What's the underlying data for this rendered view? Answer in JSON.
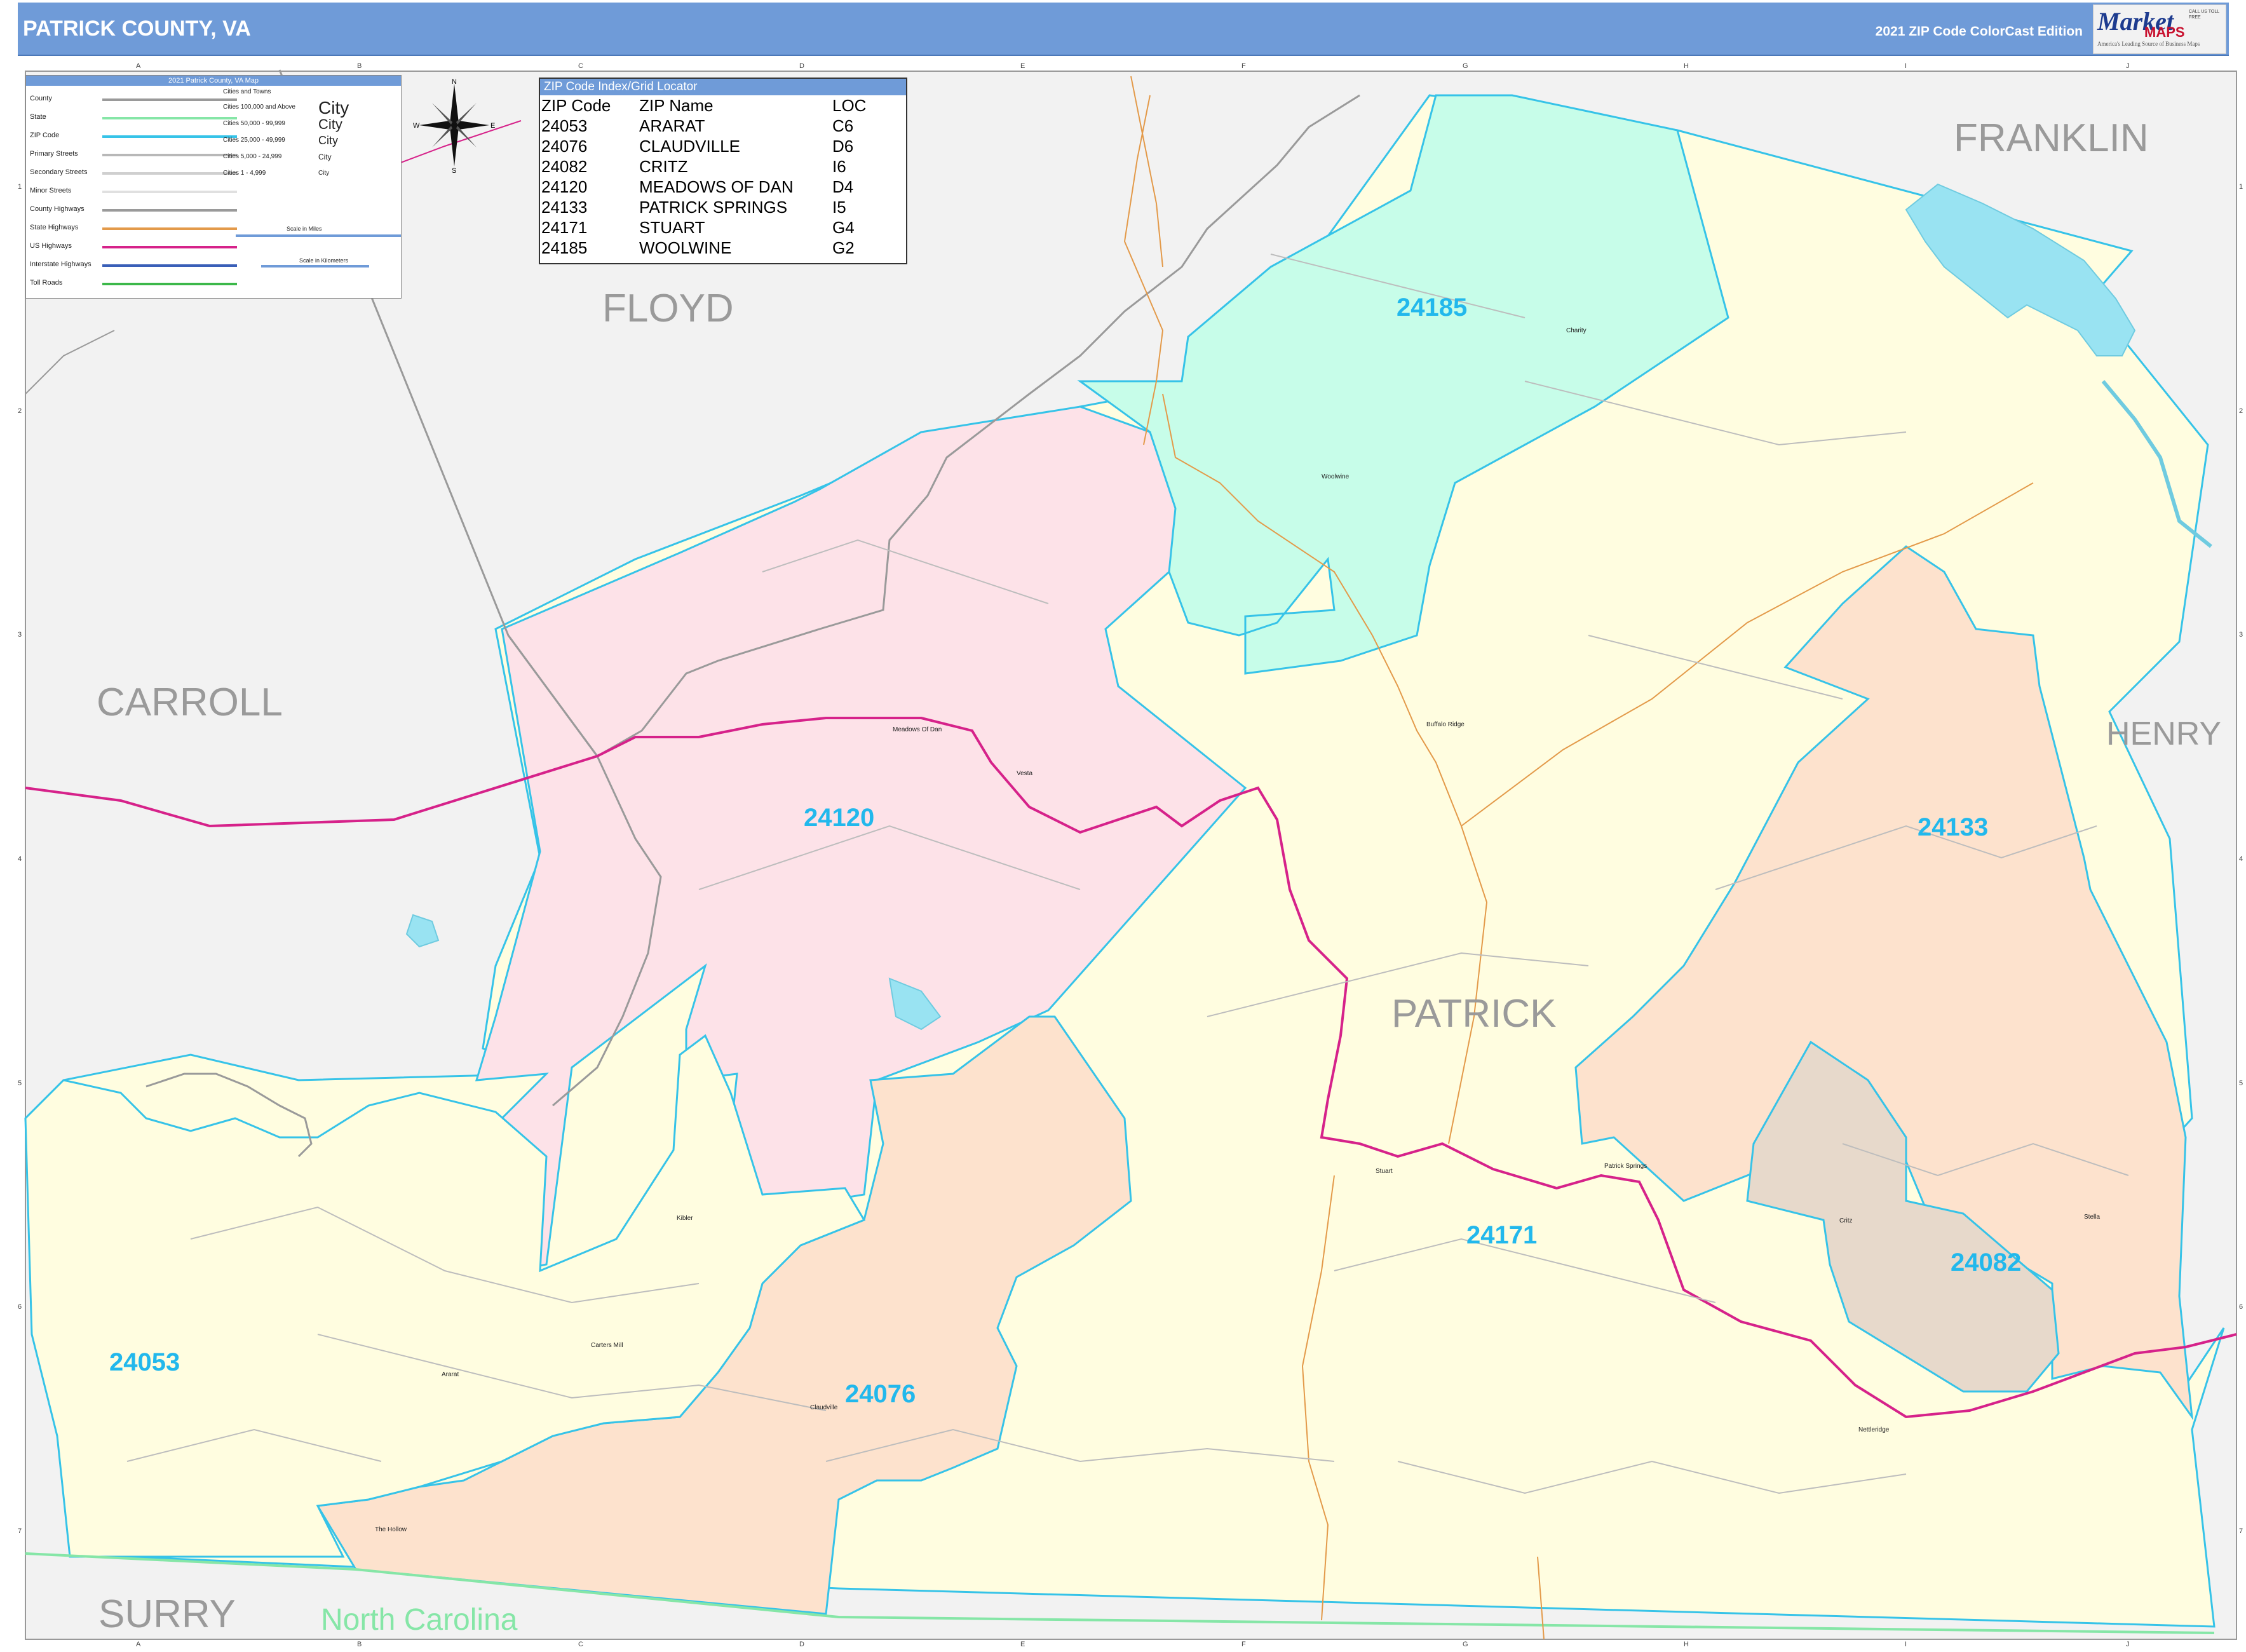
{
  "header": {
    "title": "PATRICK COUNTY, VA",
    "edition": "2021 ZIP Code ColorCast Edition"
  },
  "brand": {
    "logo_text": "Market",
    "logo_sub": "MAPS",
    "tagline": "America's Leading Source of Business Maps",
    "contact": "CALL US TOLL FREE"
  },
  "legend": {
    "title": "2021 Patrick County, VA Map",
    "items": [
      {
        "label": "County",
        "color": "#9a9a9a"
      },
      {
        "label": "State",
        "color": "#86e6a7"
      },
      {
        "label": "ZIP Code",
        "color": "#36c3e8"
      },
      {
        "label": "Primary Streets",
        "color": "#b8b8b8"
      },
      {
        "label": "Secondary Streets",
        "color": "#cfcfcf"
      },
      {
        "label": "Minor Streets",
        "color": "#e0e0e0"
      },
      {
        "label": "County Highways",
        "color": "#9a9a9a"
      },
      {
        "label": "State Highways",
        "color": "#e39a4a"
      },
      {
        "label": "US Highways",
        "color": "#d6228a"
      },
      {
        "label": "Interstate Highways",
        "color": "#3a5fb8"
      },
      {
        "label": "Toll Roads",
        "color": "#3cb84a"
      }
    ],
    "cities_heading": "Cities and Towns",
    "city_sizes": [
      {
        "label": "Cities 100,000 and Above",
        "sample": "City"
      },
      {
        "label": "Cities 50,000 - 99,999",
        "sample": "City"
      },
      {
        "label": "Cities 25,000 - 49,999",
        "sample": "City"
      },
      {
        "label": "Cities 5,000 - 24,999",
        "sample": "City"
      },
      {
        "label": "Cities 1 - 4,999",
        "sample": "City"
      }
    ],
    "scale_miles": "Scale in Miles",
    "scale_km": "Scale in Kilometers"
  },
  "compass": {
    "n": "N",
    "s": "S",
    "e": "E",
    "w": "W"
  },
  "zip_index": {
    "title": "ZIP Code Index/Grid Locator",
    "columns": [
      "ZIP Code",
      "ZIP Name",
      "LOC"
    ],
    "rows": [
      [
        "24053",
        "ARARAT",
        "C6"
      ],
      [
        "24076",
        "CLAUDVILLE",
        "D6"
      ],
      [
        "24082",
        "CRITZ",
        "I6"
      ],
      [
        "24120",
        "MEADOWS OF DAN",
        "D4"
      ],
      [
        "24133",
        "PATRICK SPRINGS",
        "I5"
      ],
      [
        "24171",
        "STUART",
        "G4"
      ],
      [
        "24185",
        "WOOLWINE",
        "G2"
      ]
    ]
  },
  "counties": {
    "floyd": "FLOYD",
    "franklin": "FRANKLIN",
    "carroll": "CARROLL",
    "henry": "HENRY",
    "patrick": "PATRICK",
    "surry": "SURRY"
  },
  "state_label": "North Carolina",
  "zip_areas": {
    "z24185": {
      "code": "24185",
      "color": "#c7fde9"
    },
    "z24120": {
      "code": "24120",
      "color": "#fde2e8"
    },
    "z24133": {
      "code": "24133",
      "color": "#fde2cd"
    },
    "z24171": {
      "code": "24171",
      "color": "#fffde0"
    },
    "z24053": {
      "code": "24053",
      "color": "#fffde0"
    },
    "z24076": {
      "code": "24076",
      "color": "#fde2cd"
    },
    "z24082": {
      "code": "24082",
      "color": "#e7d9cb"
    }
  },
  "cities": {
    "charity": "Charity",
    "woolwine": "Woolwine",
    "buffalo_ridge": "Buffalo Ridge",
    "meadows_of_dan": "Meadows Of Dan",
    "vesta": "Vesta",
    "stuart": "Stuart",
    "patrick_springs": "Patrick Springs",
    "critz": "Critz",
    "stella": "Stella",
    "kibler": "Kibler",
    "carters_mill": "Carters Mill",
    "ararat": "Ararat",
    "claudville": "Claudville",
    "the_hollow": "The Hollow",
    "ridgeway": "Nettleridge"
  },
  "grid": {
    "cols": [
      "A",
      "B",
      "C",
      "D",
      "E",
      "F",
      "G",
      "H",
      "I",
      "J"
    ],
    "rows": [
      "1",
      "2",
      "3",
      "4",
      "5",
      "6",
      "7"
    ]
  }
}
